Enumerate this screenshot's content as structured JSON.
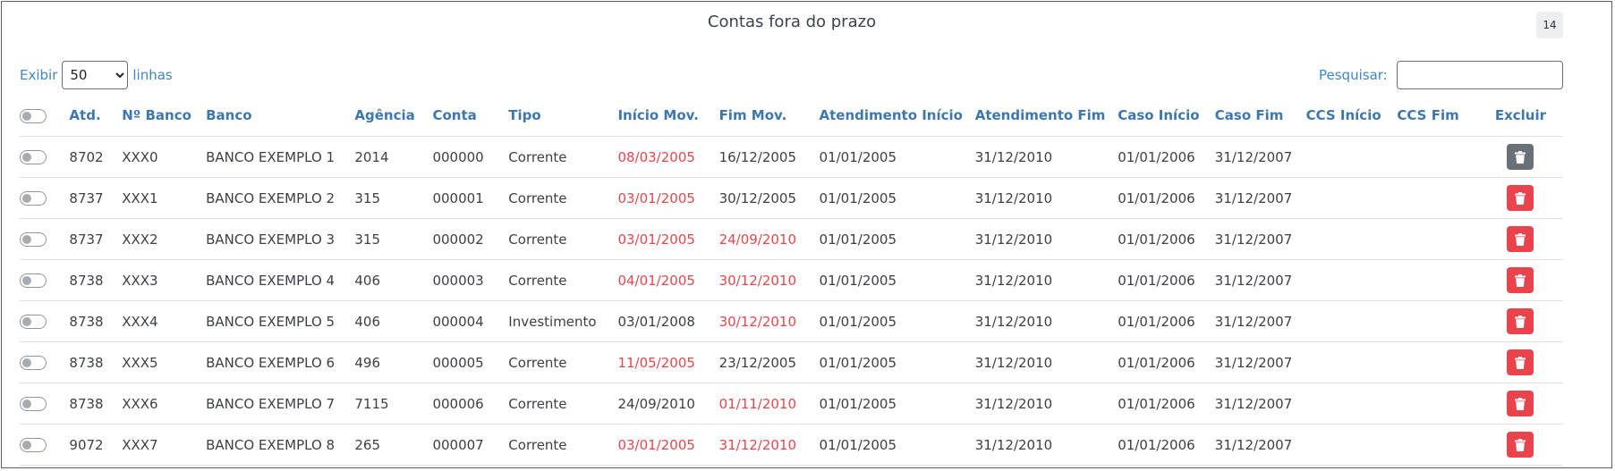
{
  "title": "Contas fora do prazo",
  "badge": "14",
  "length_menu": {
    "prefix": "Exibir",
    "value": "50",
    "suffix": "linhas"
  },
  "search": {
    "label": "Pesquisar:",
    "value": ""
  },
  "icons": {
    "toggle": "toggle-switch-icon",
    "delete": "trash-icon"
  },
  "colors": {
    "header_text": "#3e77b0",
    "late_date": "#e8464d",
    "delete_button": "#e9444c",
    "delete_button_active": "#6a7077"
  },
  "columns": [
    "Atd.",
    "Nº Banco",
    "Banco",
    "Agência",
    "Conta",
    "Tipo",
    "Início Mov.",
    "Fim Mov.",
    "Atendimento Início",
    "Atendimento Fim",
    "Caso Início",
    "Caso Fim",
    "CCS Início",
    "CCS Fim",
    "Excluir"
  ],
  "rows": [
    {
      "atd": "8702",
      "nbanco": "XXX0",
      "banco": "BANCO EXEMPLO 1",
      "agencia": "2014",
      "conta": "000000",
      "tipo": "Corrente",
      "inicio_mov": "08/03/2005",
      "inicio_mov_late": true,
      "fim_mov": "16/12/2005",
      "fim_mov_late": false,
      "atend_inicio": "01/01/2005",
      "atend_fim": "31/12/2010",
      "caso_inicio": "01/01/2006",
      "caso_fim": "31/12/2007",
      "ccs_inicio": "",
      "ccs_fim": "",
      "delete_active": true
    },
    {
      "atd": "8737",
      "nbanco": "XXX1",
      "banco": "BANCO EXEMPLO 2",
      "agencia": "315",
      "conta": "000001",
      "tipo": "Corrente",
      "inicio_mov": "03/01/2005",
      "inicio_mov_late": true,
      "fim_mov": "30/12/2005",
      "fim_mov_late": false,
      "atend_inicio": "01/01/2005",
      "atend_fim": "31/12/2010",
      "caso_inicio": "01/01/2006",
      "caso_fim": "31/12/2007",
      "ccs_inicio": "",
      "ccs_fim": "",
      "delete_active": false
    },
    {
      "atd": "8737",
      "nbanco": "XXX2",
      "banco": "BANCO EXEMPLO 3",
      "agencia": "315",
      "conta": "000002",
      "tipo": "Corrente",
      "inicio_mov": "03/01/2005",
      "inicio_mov_late": true,
      "fim_mov": "24/09/2010",
      "fim_mov_late": true,
      "atend_inicio": "01/01/2005",
      "atend_fim": "31/12/2010",
      "caso_inicio": "01/01/2006",
      "caso_fim": "31/12/2007",
      "ccs_inicio": "",
      "ccs_fim": "",
      "delete_active": false
    },
    {
      "atd": "8738",
      "nbanco": "XXX3",
      "banco": "BANCO EXEMPLO 4",
      "agencia": "406",
      "conta": "000003",
      "tipo": "Corrente",
      "inicio_mov": "04/01/2005",
      "inicio_mov_late": true,
      "fim_mov": "30/12/2010",
      "fim_mov_late": true,
      "atend_inicio": "01/01/2005",
      "atend_fim": "31/12/2010",
      "caso_inicio": "01/01/2006",
      "caso_fim": "31/12/2007",
      "ccs_inicio": "",
      "ccs_fim": "",
      "delete_active": false
    },
    {
      "atd": "8738",
      "nbanco": "XXX4",
      "banco": "BANCO EXEMPLO 5",
      "agencia": "406",
      "conta": "000004",
      "tipo": "Investimento",
      "inicio_mov": "03/01/2008",
      "inicio_mov_late": false,
      "fim_mov": "30/12/2010",
      "fim_mov_late": true,
      "atend_inicio": "01/01/2005",
      "atend_fim": "31/12/2010",
      "caso_inicio": "01/01/2006",
      "caso_fim": "31/12/2007",
      "ccs_inicio": "",
      "ccs_fim": "",
      "delete_active": false
    },
    {
      "atd": "8738",
      "nbanco": "XXX5",
      "banco": "BANCO EXEMPLO 6",
      "agencia": "496",
      "conta": "000005",
      "tipo": "Corrente",
      "inicio_mov": "11/05/2005",
      "inicio_mov_late": true,
      "fim_mov": "23/12/2005",
      "fim_mov_late": false,
      "atend_inicio": "01/01/2005",
      "atend_fim": "31/12/2010",
      "caso_inicio": "01/01/2006",
      "caso_fim": "31/12/2007",
      "ccs_inicio": "",
      "ccs_fim": "",
      "delete_active": false
    },
    {
      "atd": "8738",
      "nbanco": "XXX6",
      "banco": "BANCO EXEMPLO 7",
      "agencia": "7115",
      "conta": "000006",
      "tipo": "Corrente",
      "inicio_mov": "24/09/2010",
      "inicio_mov_late": false,
      "fim_mov": "01/11/2010",
      "fim_mov_late": true,
      "atend_inicio": "01/01/2005",
      "atend_fim": "31/12/2010",
      "caso_inicio": "01/01/2006",
      "caso_fim": "31/12/2007",
      "ccs_inicio": "",
      "ccs_fim": "",
      "delete_active": false
    },
    {
      "atd": "9072",
      "nbanco": "XXX7",
      "banco": "BANCO EXEMPLO 8",
      "agencia": "265",
      "conta": "000007",
      "tipo": "Corrente",
      "inicio_mov": "03/01/2005",
      "inicio_mov_late": true,
      "fim_mov": "31/12/2010",
      "fim_mov_late": true,
      "atend_inicio": "01/01/2005",
      "atend_fim": "31/12/2010",
      "caso_inicio": "01/01/2006",
      "caso_fim": "31/12/2007",
      "ccs_inicio": "",
      "ccs_fim": "",
      "delete_active": false
    }
  ]
}
